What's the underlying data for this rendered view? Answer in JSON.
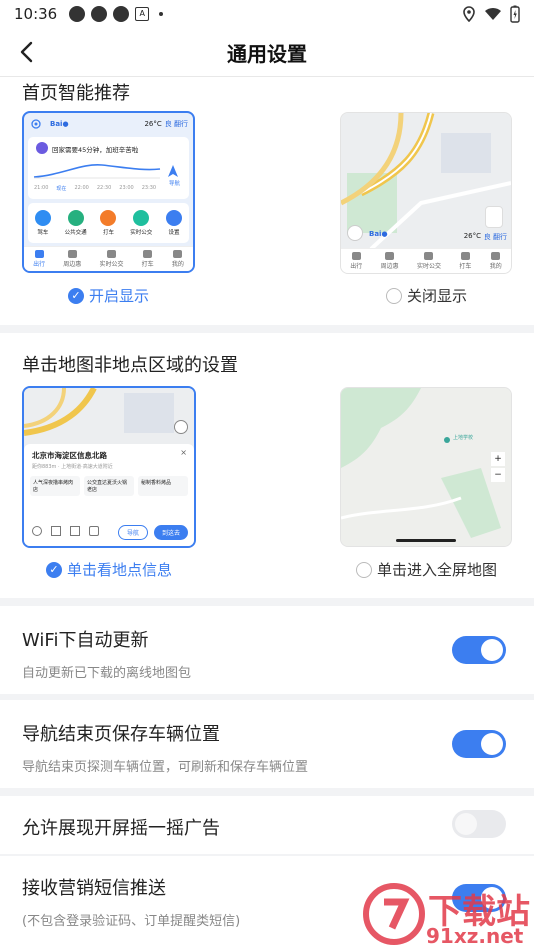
{
  "status_bar": {
    "time": "10:36"
  },
  "header": {
    "title": "通用设置"
  },
  "home_recommend": {
    "title": "首页智能推荐",
    "on_label": "开启显示",
    "off_label": "关闭显示",
    "preview": {
      "weather": "26°C",
      "aqi": "良 翻行",
      "greeting": "回家需要45分钟，加班辛苦啦",
      "times": [
        "21:00",
        "现在",
        "22:00",
        "22:30",
        "23:00",
        "23:30"
      ],
      "nav_label": "导航",
      "shortcuts": [
        "驾车",
        "公共交通",
        "打车",
        "实时公交",
        "设置"
      ],
      "tabs": [
        "出行",
        "周边惠",
        "实时公交",
        "打车",
        "我的"
      ]
    }
  },
  "map_tap": {
    "title": "单击地图非地点区域的设置",
    "on_label": "单击看地点信息",
    "off_label": "单击进入全屏地图",
    "preview": {
      "place_title": "北京市海淀区信息北路",
      "place_sub": "距你883m · 上地街道·高速大道附近",
      "cards": [
        "人气深夜撸串烤肉店",
        "公交直达夏沃火锅老店",
        "秘制香料烤品"
      ],
      "nav_btn": "导航",
      "go_btn": "到这去",
      "map_label": "上地学校",
      "zoom_plus": "+",
      "zoom_minus": "−"
    }
  },
  "settings": [
    {
      "title": "WiFi下自动更新",
      "subtitle": "自动更新已下载的离线地图包",
      "on": true
    },
    {
      "title": "导航结束页保存车辆位置",
      "subtitle": "导航结束页探测车辆位置，可刷新和保存车辆位置",
      "on": true
    },
    {
      "title": "允许展现开屏摇一摇广告",
      "subtitle": "",
      "on": false
    },
    {
      "title": "接收营销短信推送",
      "subtitle": "(不包含登录验证码、订单提醒类短信)",
      "on": true
    }
  ],
  "watermark": {
    "text": "下载站",
    "url": "91xz.net"
  },
  "colors": {
    "accent": "#3c7ef0",
    "toggle_off": "#e9eaed"
  }
}
